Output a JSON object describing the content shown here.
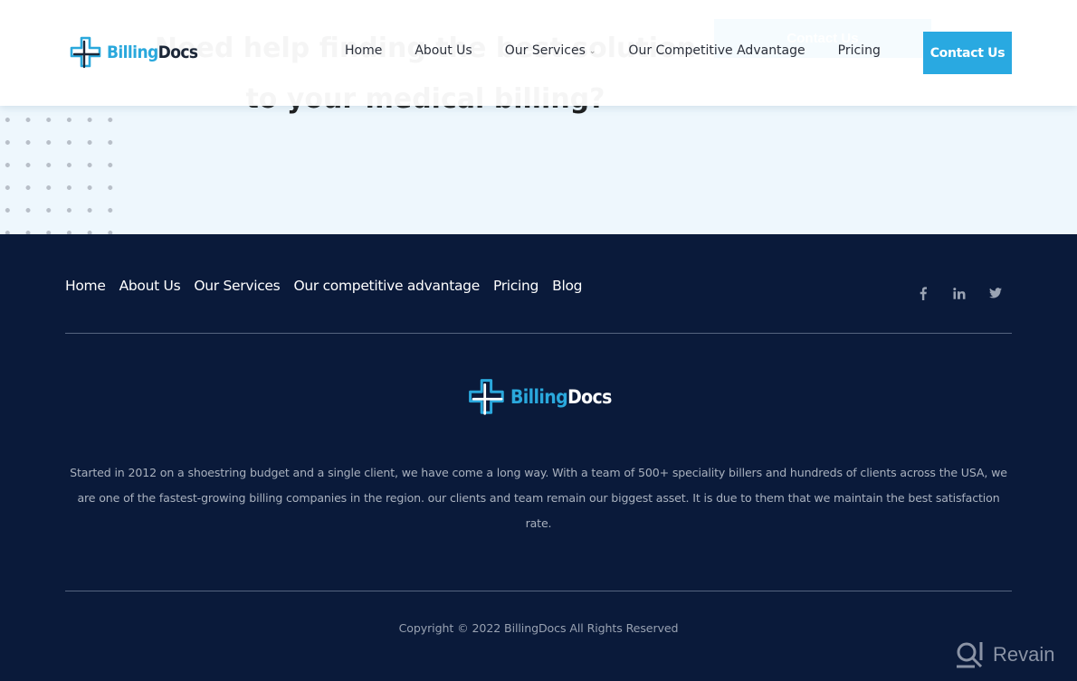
{
  "hero": {
    "heading": "Need help finding the best solution to your medical billing?",
    "cta_label": "Contact Us"
  },
  "header": {
    "logo": {
      "part1": "Billing",
      "part2": "Docs"
    },
    "nav": [
      {
        "label": "Home"
      },
      {
        "label": "About Us"
      },
      {
        "label": "Our Services",
        "has_dropdown": true
      },
      {
        "label": "Our Competitive Advantage"
      },
      {
        "label": "Pricing"
      }
    ],
    "contact_label": "Contact Us"
  },
  "footer": {
    "nav": [
      {
        "label": "Home"
      },
      {
        "label": "About Us"
      },
      {
        "label": "Our Services"
      },
      {
        "label": "Our competitive advantage"
      },
      {
        "label": "Pricing"
      },
      {
        "label": "Blog"
      }
    ],
    "social": [
      {
        "icon": "facebook-icon",
        "glyph": "f"
      },
      {
        "icon": "linkedin-icon",
        "glyph": "in"
      },
      {
        "icon": "twitter-icon",
        "glyph": "🐦"
      }
    ],
    "logo": {
      "part1": "Billing",
      "part2": "Docs"
    },
    "about": "Started in 2012 on a shoestring budget and a single client, we have come a long way. With a team of 500+ speciality billers and hundreds of clients across the USA, we are one of the fastest-growing billing companies in the region. our clients and team remain our biggest asset. It is due to them that we maintain the best satisfaction rate.",
    "copyright": "Copyright © 2022 BillingDocs All Rights Reserved"
  },
  "watermark": {
    "label": "Revain"
  },
  "colors": {
    "accent": "#29a9e1",
    "footer_bg": "#0a1a3a",
    "hero_bg": "#eef7fd",
    "nav_text": "#2a2f3a"
  }
}
